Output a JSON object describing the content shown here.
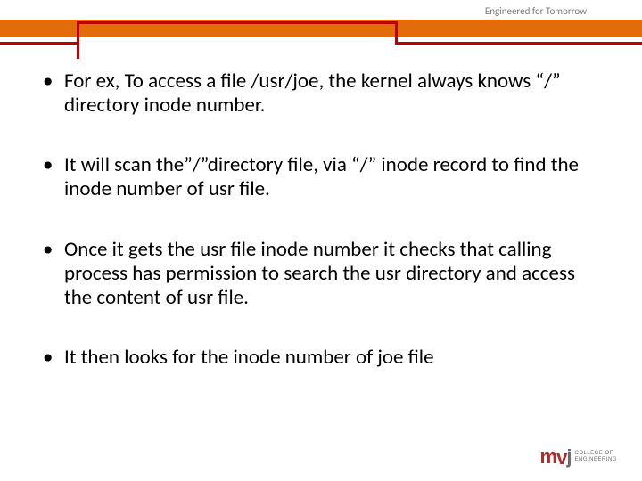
{
  "header": {
    "tagline": "Engineered for Tomorrow"
  },
  "bullets": [
    "For ex, To access a file /usr/joe, the kernel always knows “/” directory inode number.",
    "It will scan the”/”directory file, via “/” inode record to find the inode number of usr file.",
    "Once it gets the usr file inode number it checks that calling process has permission to search the usr directory and access the content of usr file.",
    "It then looks for the inode number of joe file"
  ],
  "logo": {
    "mark_m": "m",
    "mark_v": "v",
    "mark_j": "j",
    "line1": "COLLEGE OF",
    "line2": "ENGINEERING",
    "line3": ""
  }
}
